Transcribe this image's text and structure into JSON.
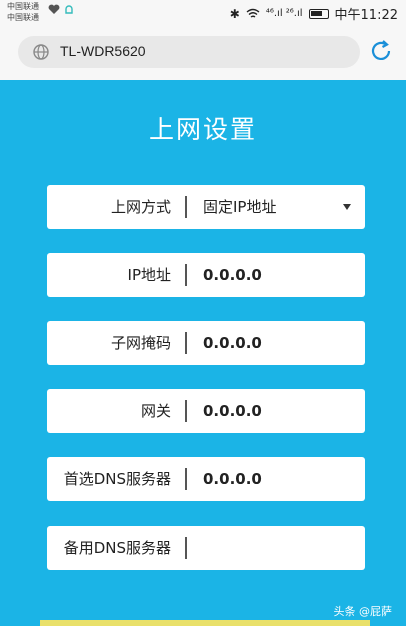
{
  "status_bar": {
    "carrier_line1": "中国联通",
    "carrier_line2": "中国联通",
    "signal_text": "⁴⁶.ıl ²⁶.ıl",
    "time": "中午11:22"
  },
  "browser": {
    "url": "TL-WDR5620"
  },
  "page": {
    "title": "上网设置",
    "fields": [
      {
        "label": "上网方式",
        "value": "固定IP地址"
      },
      {
        "label": "IP地址",
        "value": "0.0.0.0"
      },
      {
        "label": "子网掩码",
        "value": "0.0.0.0"
      },
      {
        "label": "网关",
        "value": "0.0.0.0"
      },
      {
        "label": "首选DNS服务器",
        "value": "0.0.0.0"
      },
      {
        "label": "备用DNS服务器",
        "value": ""
      }
    ]
  },
  "watermark": "头条 @屁萨",
  "colors": {
    "accent": "#1bb4e6",
    "reload_icon": "#1a8fd8"
  }
}
